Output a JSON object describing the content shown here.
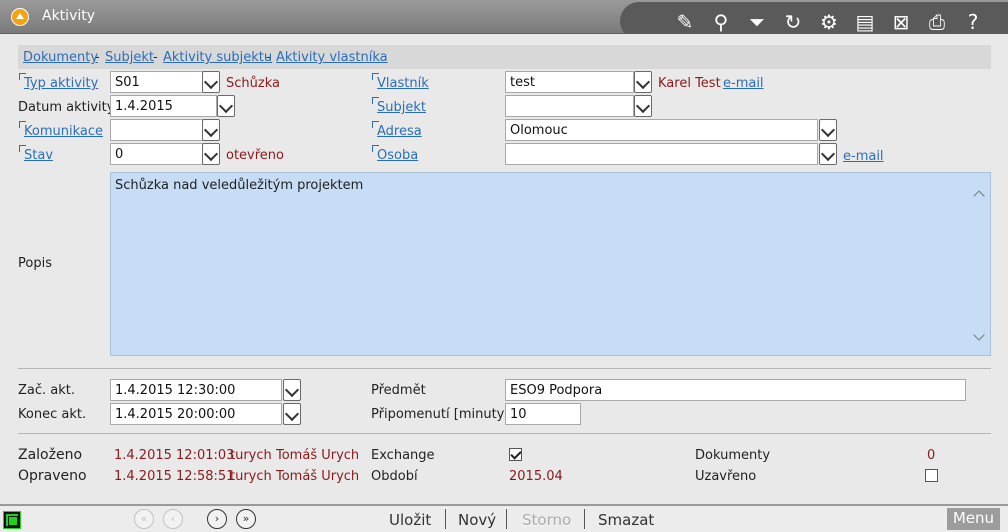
{
  "window": {
    "title": "Aktivity"
  },
  "toolbar": {
    "icons": [
      "edit-doc-icon",
      "search-icon",
      "filter-icon",
      "refresh-icon",
      "user-settings-icon",
      "document-icon",
      "excel-icon",
      "print-icon",
      "help-icon"
    ]
  },
  "tabs": {
    "dokumenty": "Dokumenty",
    "subjekt": "Subjekt",
    "aktivity_subjektu": "Aktivity subjektu",
    "aktivity_vlastnika": "Aktivity vlastníka",
    "separator": "-"
  },
  "form": {
    "typ_aktivity": {
      "label": "Typ aktivity",
      "value": "S01",
      "text": "Schůzka"
    },
    "datum_aktivity": {
      "label": "Datum aktivity",
      "value": "1.4.2015"
    },
    "komunikace": {
      "label": "Komunikace",
      "value": ""
    },
    "stav": {
      "label": "Stav",
      "value": "0",
      "text": "otevřeno"
    },
    "vlastnik": {
      "label": "Vlastník",
      "value": "test",
      "text": "Karel Test",
      "email": "e-mail"
    },
    "subjekt": {
      "label": "Subjekt",
      "value": ""
    },
    "adresa": {
      "label": "Adresa",
      "value": "Olomouc"
    },
    "osoba": {
      "label": "Osoba",
      "value": "",
      "email": "e-mail"
    },
    "popis": {
      "label": "Popis",
      "value": "Schůzka nad veledůležitým projektem"
    },
    "zac_akt": {
      "label": "Zač. akt.",
      "value": "1.4.2015 12:30:00"
    },
    "konec_akt": {
      "label": "Konec akt.",
      "value": "1.4.2015 20:00:00"
    },
    "predmet": {
      "label": "Předmět",
      "value": "ESO9 Podpora"
    },
    "pripomenuti": {
      "label": "Připomenutí [minuty]",
      "value": "10"
    }
  },
  "meta": {
    "zalozeno": {
      "label": "Založeno",
      "date": "1.4.2015 12:01:03",
      "user": "turych",
      "name": "Tomáš Urych"
    },
    "opraveno": {
      "label": "Opraveno",
      "date": "1.4.2015 12:58:51",
      "user": "turych",
      "name": "Tomáš Urych"
    },
    "exchange": {
      "label": "Exchange",
      "checked": true
    },
    "obdobi": {
      "label": "Období",
      "value": "2015.04"
    },
    "dokumenty": {
      "label": "Dokumenty",
      "value": "0"
    },
    "uzavreno": {
      "label": "Uzavřeno",
      "checked": false
    }
  },
  "footer": {
    "ulozit": "Uložit",
    "novy": "Nový",
    "storno": "Storno",
    "smazat": "Smazat",
    "menu": "Menu"
  },
  "colors": {
    "accent_link": "#2a6ebb",
    "value_red": "#8b1a1a",
    "popis_bg": "#c7ddf5"
  }
}
